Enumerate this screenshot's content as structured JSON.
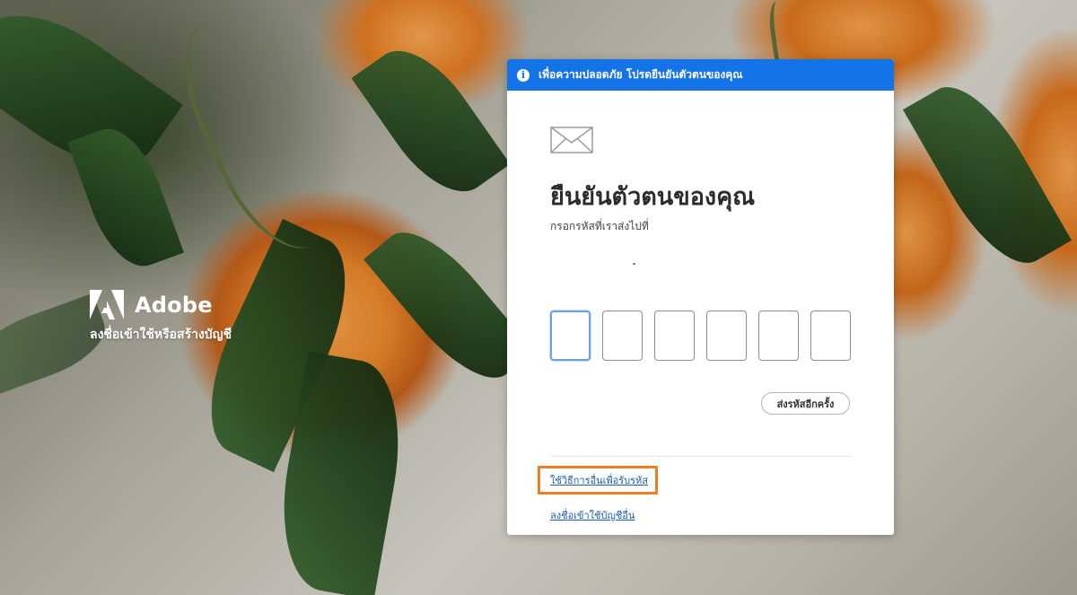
{
  "brand": {
    "name": "Adobe",
    "tagline": "ลงชื่อเข้าใช้หรือสร้างบัญชี"
  },
  "banner": {
    "text": "เพื่อความปลอดภัย โปรดยืนยันตัวตนของคุณ"
  },
  "dialog": {
    "title": "ยืนยันตัวตนของคุณ",
    "subtitle": "กรอกรหัสที่เราส่งไปที่",
    "code_digits": [
      "",
      "",
      "",
      "",
      "",
      ""
    ],
    "resend_label": "ส่งรหัสอีกครั้ง",
    "alt_method_link": "ใช้วิธีการอื่นเพื่อรับรหัส",
    "other_account_link": "ลงชื่อเข้าใช้บัญชีอื่น"
  },
  "colors": {
    "banner": "#1473e6",
    "highlight": "#ef7d22",
    "link": "#1a5dab"
  },
  "icons": [
    "adobe-logo",
    "info-icon",
    "mail-icon"
  ]
}
